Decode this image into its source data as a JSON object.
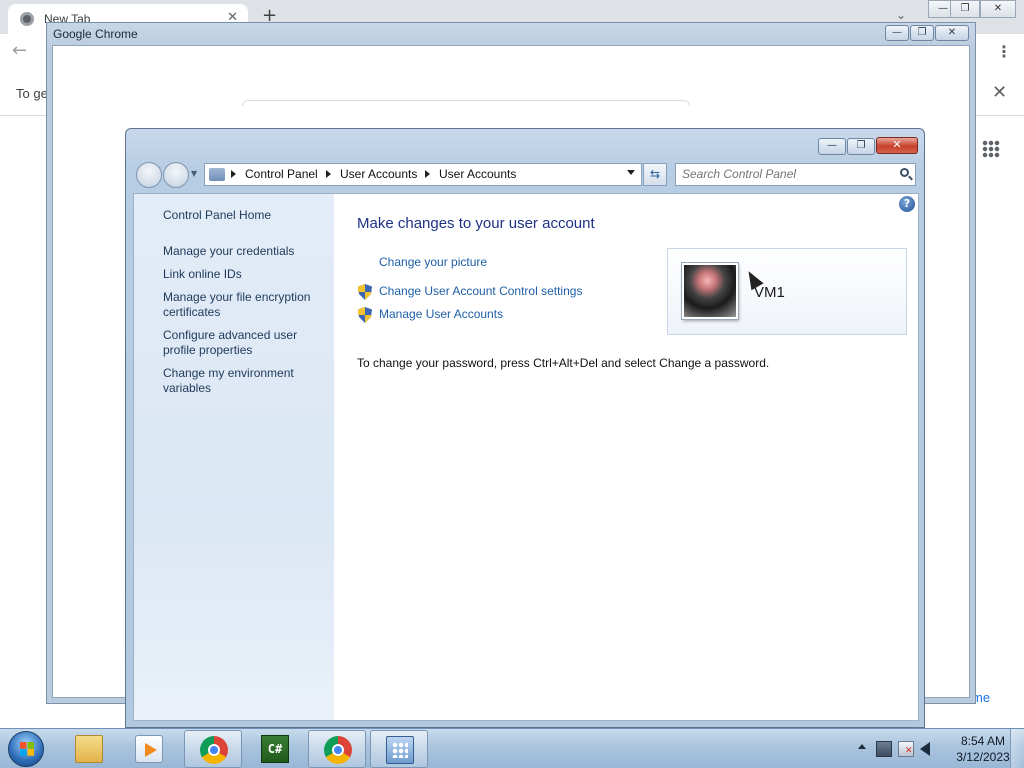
{
  "chrome": {
    "tab_title": "New Tab",
    "tab_close": "✕",
    "new_tab": "+",
    "tab_search": "⌄",
    "caption": {
      "minimize": "—",
      "restore": "❐",
      "close": "✕"
    },
    "back": "←",
    "menu": "⋮",
    "infobar_text": "To ge",
    "infobar_close": "✕",
    "customize_text": "me"
  },
  "gc_window": {
    "title": "Google Chrome",
    "caption": {
      "minimize": "—",
      "maximize": "❐",
      "close": "✕"
    }
  },
  "ua_window": {
    "caption": {
      "minimize": "—",
      "maximize": "❐",
      "close": "✕"
    },
    "breadcrumb": [
      "Control Panel",
      "User Accounts",
      "User Accounts"
    ],
    "refresh": "⇆",
    "search_placeholder": "Search Control Panel",
    "help": "?",
    "left_pane": [
      "Control Panel Home",
      "Manage your credentials",
      "Link online IDs",
      "Manage your file encryption certificates",
      "Configure advanced user profile properties",
      "Change my environment variables"
    ],
    "main": {
      "title": "Make changes to your user account",
      "links": {
        "change_picture": "Change your picture",
        "uac_settings": "Change User Account Control settings",
        "manage_accounts": "Manage User Accounts"
      },
      "password_note": "To change your password, press Ctrl+Alt+Del and select Change a password."
    },
    "account": {
      "name": "VM1"
    }
  },
  "taskbar": {
    "pinned": [
      {
        "name": "Windows Explorer",
        "icon": "folder-icon",
        "active": false
      },
      {
        "name": "Windows Media Player",
        "icon": "media-player-icon",
        "active": false
      },
      {
        "name": "Google Chrome",
        "icon": "chrome-icon",
        "active": true
      },
      {
        "name": "C# IDE",
        "icon": "csharp-icon",
        "active": false
      },
      {
        "name": "Google Chrome",
        "icon": "chrome-icon",
        "active": true
      },
      {
        "name": "Control Panel",
        "icon": "control-panel-icon",
        "active": true
      }
    ],
    "clock": {
      "time": "8:54 AM",
      "date": "3/12/2023"
    }
  }
}
